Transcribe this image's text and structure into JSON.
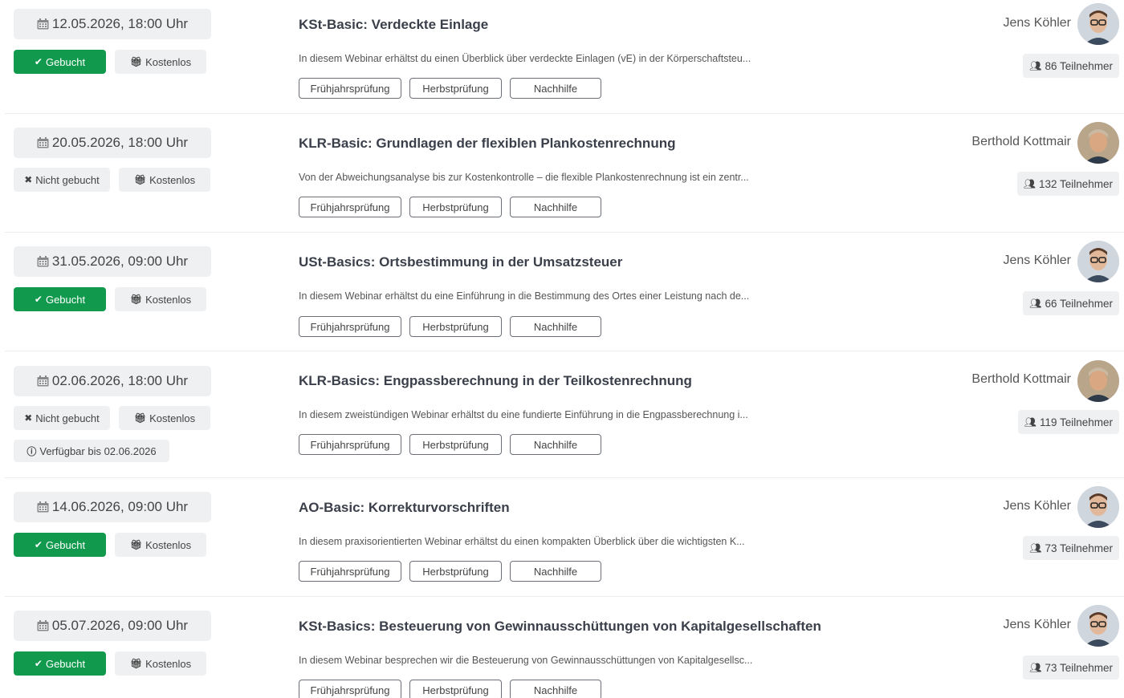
{
  "labels": {
    "booked": "Gebucht",
    "not_booked": "Nicht gebucht",
    "free": "Kostenlos",
    "tags": [
      "Frühjahrsprüfung",
      "Herbstprüfung",
      "Nachhilfe"
    ]
  },
  "colors": {
    "booked_green": "#119a4d",
    "badge_gray": "#eef0f2"
  },
  "icons": {
    "calendar": "calendar-icon",
    "check": "check-icon",
    "cross": "cross-icon",
    "gift": "gift-icon",
    "info": "info-icon",
    "users": "users-icon"
  },
  "webinars": [
    {
      "date": "12.05.2026, 18:00 Uhr",
      "status": "Gebucht",
      "price": "Kostenlos",
      "title": "KSt-Basic: Verdeckte Einlage",
      "description": "In diesem Webinar erhältst du einen Überblick über verdeckte Einlagen (vE) in der Körperschaftsteu...",
      "speaker": "Jens Köhler",
      "participants": "86 Teilnehmer"
    },
    {
      "date": "20.05.2026, 18:00 Uhr",
      "status": "Nicht gebucht",
      "price": "Kostenlos",
      "title": "KLR-Basic: Grundlagen der flexiblen Plankostenrechnung",
      "description": "Von der Abweichungsanalyse bis zur Kostenkontrolle – die flexible Plankostenrechnung ist ein zentr...",
      "speaker": "Berthold Kottmair",
      "participants": "132 Teilnehmer"
    },
    {
      "date": "31.05.2026, 09:00 Uhr",
      "status": "Gebucht",
      "price": "Kostenlos",
      "title": "USt-Basics: Ortsbestimmung in der Umsatzsteuer",
      "description": "In diesem Webinar erhältst du eine Einführung in die Bestimmung des Ortes einer Leistung nach de...",
      "speaker": "Jens Köhler",
      "participants": "66 Teilnehmer"
    },
    {
      "date": "02.06.2026, 18:00 Uhr",
      "status": "Nicht gebucht",
      "price": "Kostenlos",
      "available": "Verfügbar bis 02.06.2026",
      "title": "KLR-Basics: Engpassberechnung in der Teilkostenrechnung",
      "description": "In diesem zweistündigen Webinar erhältst du eine fundierte Einführung in die Engpassberechnung i...",
      "speaker": "Berthold Kottmair",
      "participants": "119 Teilnehmer"
    },
    {
      "date": "14.06.2026, 09:00 Uhr",
      "status": "Gebucht",
      "price": "Kostenlos",
      "title": "AO-Basic: Korrekturvorschriften",
      "description": "In diesem praxisorientierten Webinar erhältst du einen kompakten Überblick über die wichtigsten K...",
      "speaker": "Jens Köhler",
      "participants": "73 Teilnehmer"
    },
    {
      "date": "05.07.2026, 09:00 Uhr",
      "status": "Gebucht",
      "price": "Kostenlos",
      "title": "KSt-Basics: Besteuerung von Gewinnausschüttungen von Kapitalgesellschaften",
      "description": "In diesem Webinar besprechen wir die Besteuerung von Gewinnausschüttungen von Kapitalgesellsc...",
      "speaker": "Jens Köhler",
      "participants": "73 Teilnehmer"
    }
  ]
}
